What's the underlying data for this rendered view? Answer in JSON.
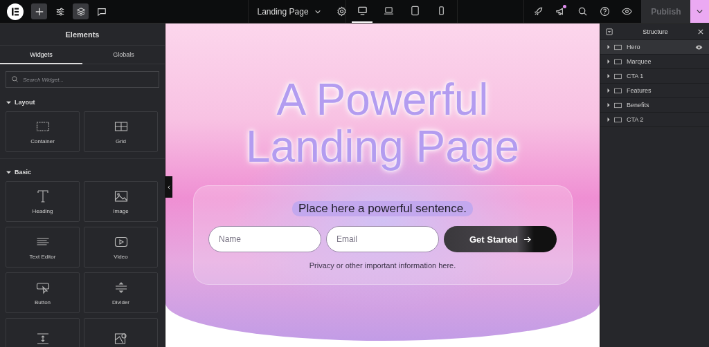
{
  "topbar": {
    "tools": [
      {
        "kind": "add",
        "selected": true
      },
      {
        "kind": "settings",
        "selected": false
      },
      {
        "kind": "layers",
        "selected": true
      },
      {
        "kind": "comments",
        "selected": false
      }
    ],
    "page_title": "Landing Page",
    "devices": [
      {
        "kind": "desktop",
        "selected": true
      },
      {
        "kind": "laptop",
        "selected": false
      },
      {
        "kind": "tablet",
        "selected": false
      },
      {
        "kind": "phone",
        "selected": false
      }
    ],
    "actions": [
      {
        "kind": "rocket",
        "badge": false
      },
      {
        "kind": "megaphone",
        "badge": true
      },
      {
        "kind": "search",
        "badge": false
      },
      {
        "kind": "help",
        "badge": false
      },
      {
        "kind": "preview",
        "badge": false
      }
    ],
    "publish": {
      "label": "Publish",
      "disabled": true
    }
  },
  "elements_panel": {
    "title": "Elements",
    "tabs": [
      {
        "label": "Widgets",
        "selected": true
      },
      {
        "label": "Globals",
        "selected": false
      }
    ],
    "search": {
      "placeholder": "Search Widget..."
    },
    "sections": [
      {
        "title": "Layout",
        "expanded": true,
        "widgets": [
          {
            "kind": "container",
            "label": "Container"
          },
          {
            "kind": "grid",
            "label": "Grid"
          }
        ]
      },
      {
        "title": "Basic",
        "expanded": true,
        "widgets": [
          {
            "kind": "heading",
            "label": "Heading"
          },
          {
            "kind": "image",
            "label": "Image"
          },
          {
            "kind": "text",
            "label": "Text Editor"
          },
          {
            "kind": "video",
            "label": "Video"
          },
          {
            "kind": "button",
            "label": "Button"
          },
          {
            "kind": "divider",
            "label": "Divider"
          },
          {
            "kind": "spacer"
          },
          {
            "kind": "map"
          }
        ]
      }
    ]
  },
  "hero": {
    "title": "A Powerful Landing Page",
    "sentence": "Place here a powerful sentence.",
    "name_field": {
      "placeholder": "Name"
    },
    "email_field": {
      "placeholder": "Email"
    },
    "cta": "Get Started",
    "note": "Privacy or other important information here."
  },
  "structure": {
    "title": "Structure",
    "items": [
      {
        "label": "Hero",
        "selected": true
      },
      {
        "label": "Marquee",
        "selected": false
      },
      {
        "label": "CTA 1",
        "selected": false
      },
      {
        "label": "Features",
        "selected": false
      },
      {
        "label": "Benefits",
        "selected": false
      },
      {
        "label": "CTA 2",
        "selected": false
      }
    ]
  }
}
